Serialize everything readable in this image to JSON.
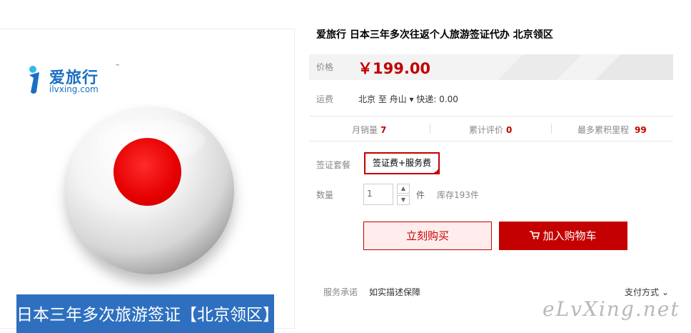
{
  "product": {
    "logo_cn": "爱旅行",
    "logo_tm": "™",
    "logo_en": "ilvxing.com",
    "banner_text": "日本三年多次旅游签证【北京领区】",
    "title": "爱旅行 日本三年多次往返个人旅游签证代办 北京领区"
  },
  "price": {
    "label": "价格",
    "value": "￥199.00"
  },
  "shipping": {
    "label": "运费",
    "text": "北京  至 舟山 ▾ 快递: 0.00"
  },
  "stats": {
    "monthly_sales_label": "月销量",
    "monthly_sales": "7",
    "reviews_label": "累计评价",
    "reviews": "0",
    "points_label": "最多累积里程",
    "points": "99"
  },
  "package": {
    "label": "签证套餐",
    "option": "签证费+服务费"
  },
  "quantity": {
    "label": "数量",
    "value": "1",
    "unit": "件",
    "stock": "库存193件"
  },
  "actions": {
    "buy_now": "立刻购买",
    "add_to_cart": "加入购物车"
  },
  "service": {
    "label": "服务承诺",
    "text": "如实描述保障",
    "payment": "支付方式"
  },
  "watermark": "eLvXing.net",
  "colors": {
    "accent": "#c40000",
    "banner": "#2e70bf"
  }
}
